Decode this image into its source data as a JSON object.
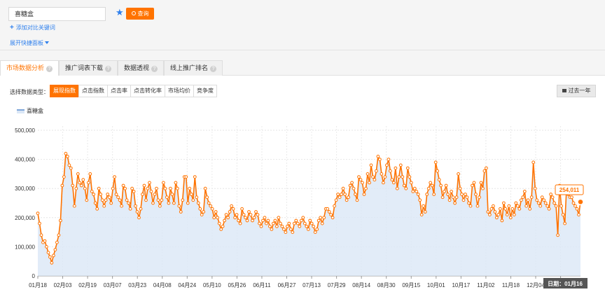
{
  "search": {
    "value": "喜糖盒",
    "query_label": "查询"
  },
  "links": {
    "add_compare": "添加对比关键词",
    "expand_panel": "展开快捷面板"
  },
  "tabs": [
    {
      "label": "市场数据分析",
      "active": true
    },
    {
      "label": "推广词表下载",
      "active": false
    },
    {
      "label": "数据透视",
      "active": false
    },
    {
      "label": "线上推广排名",
      "active": false
    }
  ],
  "metrics": {
    "type_label": "选择数据类型：",
    "items": [
      {
        "label": "展现指数",
        "active": true
      },
      {
        "label": "点击指数",
        "active": false
      },
      {
        "label": "点击率",
        "active": false
      },
      {
        "label": "点击转化率",
        "active": false
      },
      {
        "label": "市场均价",
        "active": false
      },
      {
        "label": "竞争度",
        "active": false
      }
    ],
    "range_button": "过去一年"
  },
  "colors": {
    "accent": "#ff7300",
    "link": "#2f80ed",
    "line": "#ff7300",
    "area": "#dbe7f6"
  },
  "chart_data": {
    "type": "line",
    "series": [
      {
        "name": "喜糖盒",
        "values": [
          215000,
          180000,
          140000,
          115000,
          120000,
          100000,
          80000,
          65000,
          45000,
          70000,
          90000,
          115000,
          140000,
          190000,
          310000,
          340000,
          420000,
          410000,
          380000,
          370000,
          310000,
          240000,
          300000,
          350000,
          320000,
          310000,
          330000,
          300000,
          260000,
          320000,
          350000,
          290000,
          280000,
          250000,
          230000,
          300000,
          280000,
          260000,
          240000,
          260000,
          280000,
          270000,
          250000,
          300000,
          340000,
          280000,
          270000,
          260000,
          240000,
          310000,
          300000,
          260000,
          250000,
          230000,
          300000,
          290000,
          240000,
          220000,
          200000,
          230000,
          280000,
          310000,
          260000,
          300000,
          320000,
          290000,
          250000,
          280000,
          300000,
          260000,
          240000,
          260000,
          320000,
          300000,
          270000,
          250000,
          300000,
          280000,
          250000,
          320000,
          300000,
          240000,
          220000,
          260000,
          340000,
          340000,
          250000,
          300000,
          280000,
          260000,
          340000,
          270000,
          250000,
          230000,
          210000,
          220000,
          300000,
          270000,
          250000,
          240000,
          230000,
          200000,
          220000,
          200000,
          180000,
          160000,
          170000,
          190000,
          210000,
          200000,
          220000,
          240000,
          230000,
          200000,
          210000,
          190000,
          180000,
          230000,
          210000,
          200000,
          190000,
          220000,
          210000,
          190000,
          200000,
          220000,
          210000,
          180000,
          170000,
          190000,
          200000,
          180000,
          190000,
          170000,
          160000,
          180000,
          190000,
          170000,
          200000,
          180000,
          170000,
          160000,
          150000,
          170000,
          180000,
          160000,
          150000,
          180000,
          190000,
          180000,
          170000,
          190000,
          200000,
          180000,
          170000,
          160000,
          190000,
          180000,
          170000,
          150000,
          160000,
          190000,
          200000,
          180000,
          200000,
          230000,
          230000,
          220000,
          210000,
          200000,
          240000,
          260000,
          280000,
          270000,
          280000,
          300000,
          280000,
          260000,
          270000,
          310000,
          320000,
          300000,
          280000,
          260000,
          340000,
          330000,
          320000,
          280000,
          300000,
          350000,
          320000,
          380000,
          340000,
          330000,
          360000,
          410000,
          400000,
          350000,
          320000,
          340000,
          380000,
          400000,
          360000,
          330000,
          320000,
          370000,
          300000,
          340000,
          380000,
          340000,
          310000,
          300000,
          370000,
          340000,
          320000,
          290000,
          300000,
          290000,
          280000,
          260000,
          210000,
          240000,
          220000,
          280000,
          300000,
          320000,
          310000,
          280000,
          390000,
          360000,
          330000,
          310000,
          270000,
          290000,
          310000,
          280000,
          260000,
          290000,
          270000,
          250000,
          270000,
          350000,
          300000,
          280000,
          260000,
          280000,
          270000,
          250000,
          240000,
          310000,
          320000,
          280000,
          240000,
          270000,
          320000,
          300000,
          360000,
          370000,
          220000,
          210000,
          230000,
          240000,
          220000,
          200000,
          210000,
          230000,
          190000,
          250000,
          230000,
          210000,
          240000,
          200000,
          230000,
          210000,
          250000,
          240000,
          230000,
          260000,
          270000,
          290000,
          240000,
          260000,
          230000,
          270000,
          390000,
          300000,
          260000,
          250000,
          240000,
          270000,
          260000,
          250000,
          240000,
          230000,
          280000,
          270000,
          250000,
          240000,
          140000,
          310000,
          240000,
          210000,
          180000,
          300000,
          280000,
          270000,
          270000,
          250000,
          240000,
          230000,
          210000,
          254011
        ]
      }
    ],
    "x_labels": [
      "01月18",
      "02月03",
      "02月19",
      "03月07",
      "03月23",
      "04月08",
      "04月24",
      "05月10",
      "05月26",
      "06月11",
      "06月27",
      "07月13",
      "07月29",
      "08月14",
      "08月30",
      "09月15",
      "10月01",
      "10月17",
      "11月02",
      "11月18",
      "12月04",
      "12月"
    ],
    "y_ticks": [
      "0",
      "100,000",
      "200,000",
      "300,000",
      "400,000",
      "500,000"
    ],
    "ylim": [
      0,
      500000
    ],
    "last_value_label": "254,011",
    "tooltip_date": "日期：01月16"
  }
}
